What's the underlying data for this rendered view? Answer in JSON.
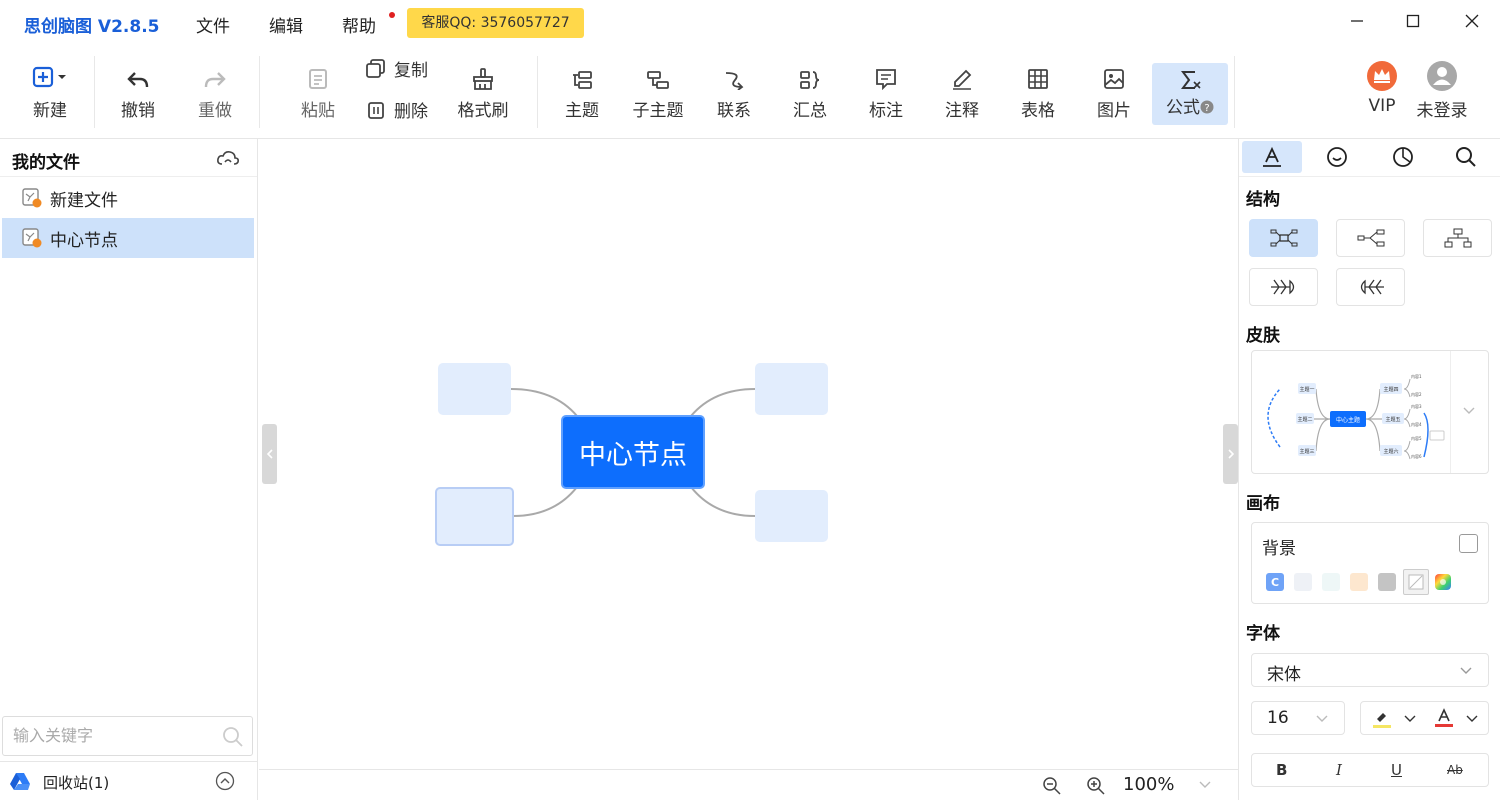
{
  "app": {
    "title": "思创脑图 V2.8.5"
  },
  "menu": {
    "file": "文件",
    "edit": "编辑",
    "help": "帮助"
  },
  "support_badge": "客服QQ: 3576057727",
  "toolbar": {
    "new": "新建",
    "undo": "撤销",
    "redo": "重做",
    "paste": "粘贴",
    "copy": "复制",
    "delete": "删除",
    "format_brush": "格式刷",
    "topic": "主题",
    "subtopic": "子主题",
    "relation": "联系",
    "summary": "汇总",
    "label": "标注",
    "note": "注释",
    "table": "表格",
    "image": "图片",
    "formula": "公式",
    "vip": "VIP",
    "login": "未登录"
  },
  "sidebar": {
    "title": "我的文件",
    "files": [
      {
        "name": "新建文件",
        "selected": false
      },
      {
        "name": "中心节点",
        "selected": true
      }
    ],
    "search_placeholder": "输入关键字",
    "recycle": "回收站(1)"
  },
  "canvas": {
    "center_node": "中心节点",
    "zoom": "100%"
  },
  "right_panel": {
    "structure_title": "结构",
    "skin_title": "皮肤",
    "skin_preview": {
      "center": "中心主题",
      "left_topics": [
        "主题一",
        "主题二",
        "主题三"
      ],
      "right_topics": [
        "主题四",
        "主题五",
        "主题六"
      ],
      "sub_topics": [
        "内容1",
        "内容2",
        "内容3",
        "内容4",
        "内容5",
        "内容6"
      ]
    },
    "canvas_title": "画布",
    "background_label": "背景",
    "swatch_colors": [
      "#6fa3f7",
      "#eef1f6",
      "#eef7f7",
      "#fde7cf",
      "#c4c4c4"
    ],
    "font_title": "字体",
    "font_family": "宋体",
    "font_size": "16",
    "highlight_color": "#f5e663",
    "text_color": "#e53935",
    "format_buttons": [
      "B",
      "I",
      "U",
      "Ab"
    ]
  },
  "colors": {
    "accent": "#1a5fd8",
    "node_primary": "#0d6efd",
    "node_secondary": "#e2edfd",
    "badge": "#ffd84a"
  }
}
